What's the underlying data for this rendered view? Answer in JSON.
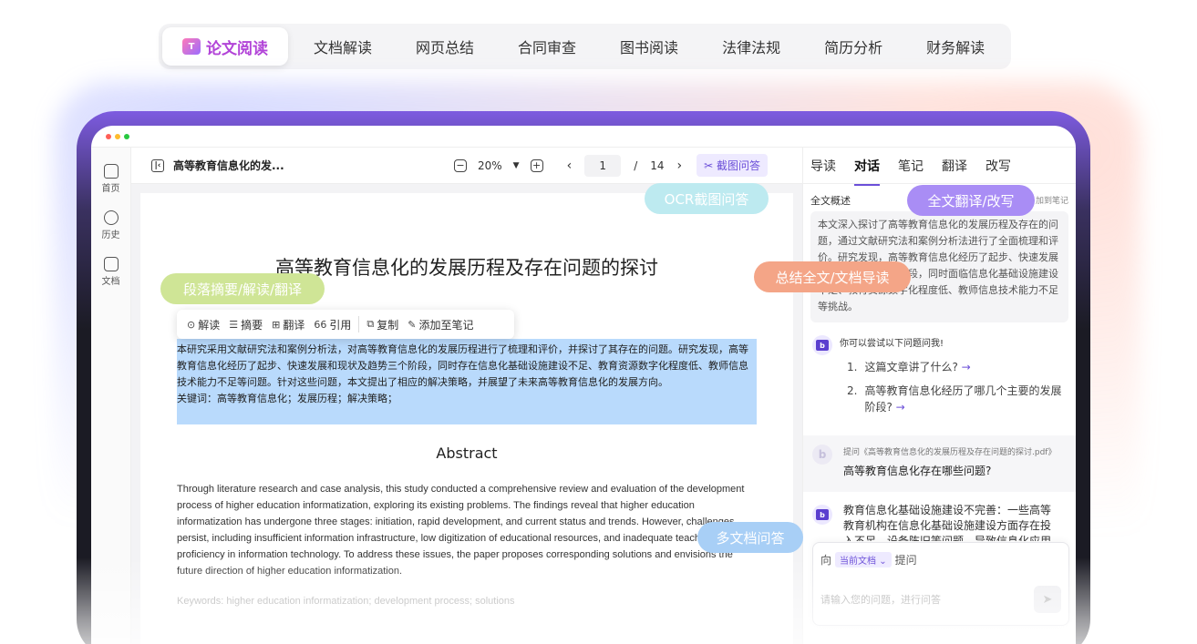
{
  "top_tabs": [
    {
      "label": "论文阅读",
      "active": true
    },
    {
      "label": "文档解读"
    },
    {
      "label": "网页总结"
    },
    {
      "label": "合同审查"
    },
    {
      "label": "图书阅读"
    },
    {
      "label": "法律法规"
    },
    {
      "label": "简历分析"
    },
    {
      "label": "财务解读"
    }
  ],
  "tab_logo": "T",
  "rail": {
    "home": "首页",
    "history": "历史",
    "docs": "文档"
  },
  "toolbar": {
    "doc_title": "高等教育信息化的发...",
    "zoom": "20%",
    "page_current": "1",
    "page_sep": "/",
    "page_total": "14",
    "crop_qa": "截图问答"
  },
  "paper": {
    "title": "高等教育信息化的发展历程及存在问题的探讨",
    "abstract_cn": "本研究采用文献研究法和案例分析法，对高等教育信息化的发展历程进行了梳理和评价，并探讨了其存在的问题。研究发现，高等教育信息化经历了起步、快速发展和现状及趋势三个阶段，同时存在信息化基础设施建设不足、教育资源数字化程度低、教师信息技术能力不足等问题。针对这些问题，本文提出了相应的解决策略，并展望了未来高等教育信息化的发展方向。",
    "keywords_cn": "关键词：高等教育信息化；发展历程；解决策略；",
    "abstract_heading": "Abstract",
    "abstract_en": "Through literature research and case analysis, this study conducted a comprehensive review and evaluation of the development process of higher education informatization, exploring its existing problems. The findings reveal that higher education informatization has undergone three stages: initiation, rapid development, and current status and trends. However, challenges persist, including insufficient information infrastructure, low digitization of educational resources, and inadequate teacher proficiency in information technology. To address these issues, the paper proposes corresponding solutions and envisions the future direction of higher education informatization.",
    "keywords_en": "Keywords: higher education informatization; development process; solutions"
  },
  "selection_toolbar": {
    "explain": "解读",
    "summary": "摘要",
    "translate": "翻译",
    "cite": "引用",
    "copy": "复制",
    "add_note": "添加至笔记"
  },
  "right_panel": {
    "tabs": [
      {
        "label": "导读"
      },
      {
        "label": "对话",
        "active": true
      },
      {
        "label": "笔记"
      },
      {
        "label": "翻译"
      },
      {
        "label": "改写"
      }
    ],
    "summary_label": "全文概述",
    "add_to_note": "加到笔记",
    "summary_text": "本文深入探讨了高等教育信息化的发展历程及存在的问题，通过文献研究法和案例分析法进行了全面梳理和评价。研究发现，高等教育信息化经历了起步、快速发展和现状及趋势三个阶段，同时面临信息化基础设施建设不足、教育资源数字化程度低、教师信息技术能力不足等挑战。",
    "bot_hint": "你可以尝试以下问题问我!",
    "questions": [
      {
        "num": "1.",
        "text": "这篇文章讲了什么?"
      },
      {
        "num": "2.",
        "text": "高等教育信息化经历了哪几个主要的发展阶段?"
      }
    ],
    "user_ref": "提问《高等教育信息化的发展历程及存在问题的探讨.pdf》",
    "user_question": "高等教育信息化存在哪些问题?",
    "answer": "教育信息化基础设施建设不完善：一些高等教育机构在信息化基础设施建设方面存在投入不足、设备陈旧等问题，导致信息化应用",
    "input_to": "向",
    "input_scope": "当前文档",
    "input_ask": "提问",
    "input_placeholder": "请输入您的问题，进行问答"
  },
  "pills": {
    "ocr": "OCR截图问答",
    "translate": "全文翻译/改写",
    "summary": "总结全文/文档导读",
    "paragraph": "段落摘要/解读/翻译",
    "multi_doc": "多文档问答"
  },
  "colors": {
    "accent": "#6b4fd8",
    "active_tab": "#b244d8",
    "selection": "#b9dafc"
  }
}
